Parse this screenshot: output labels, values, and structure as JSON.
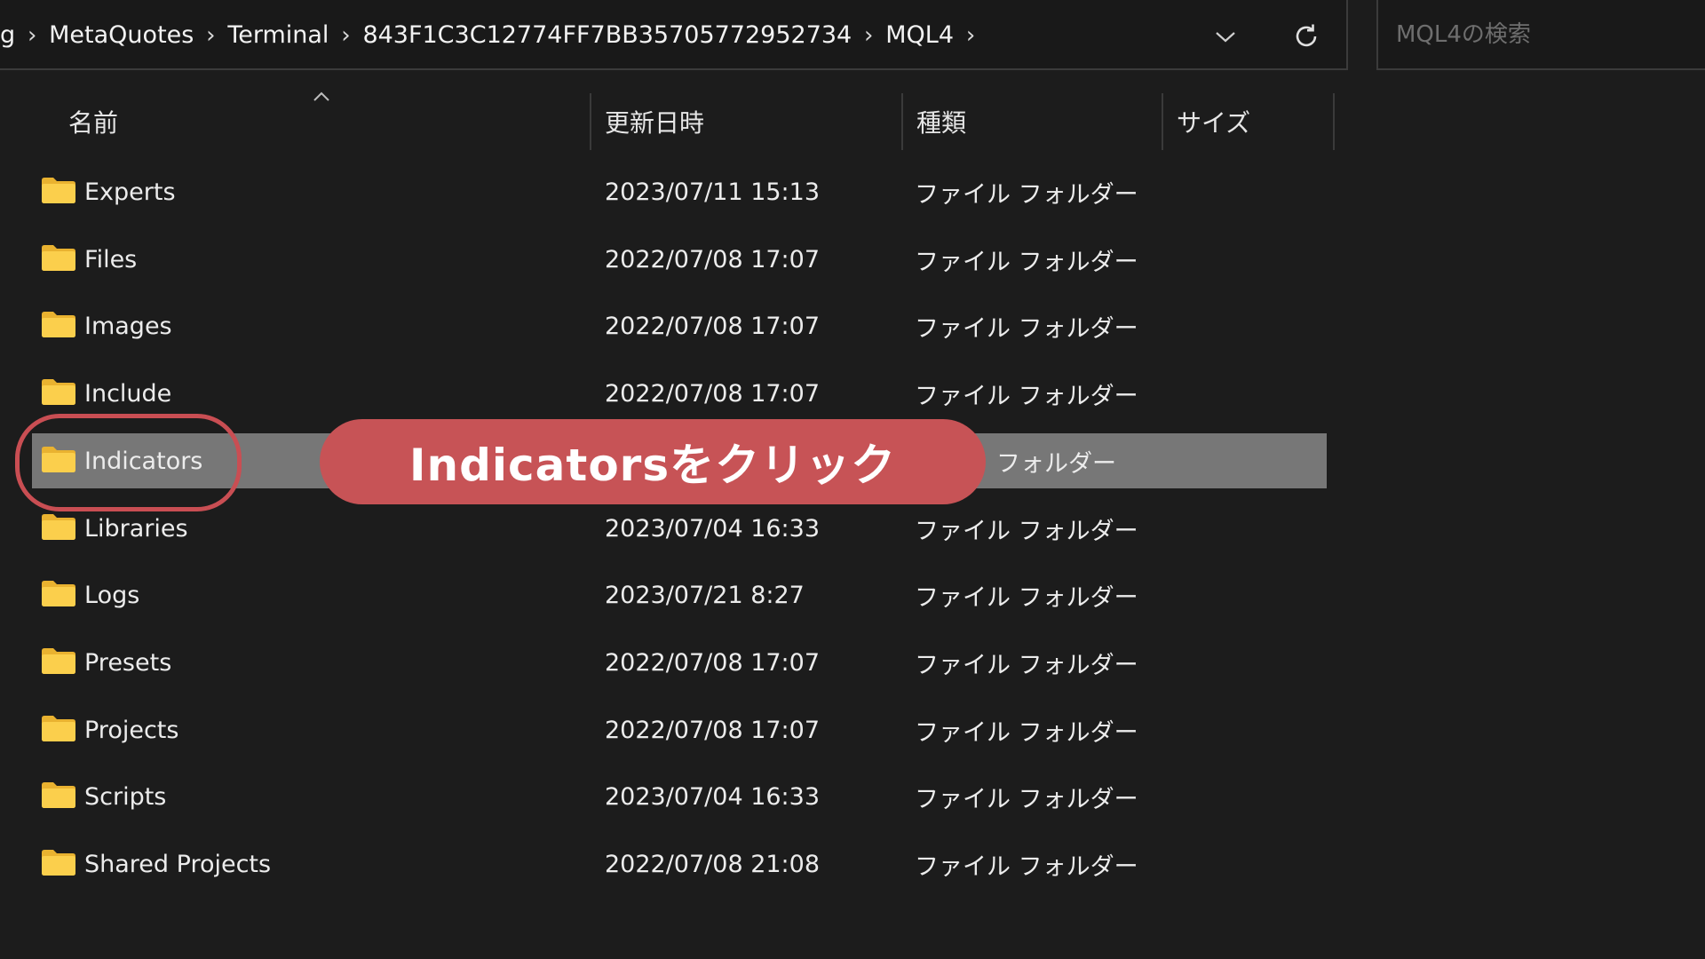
{
  "address_bar": {
    "breadcrumb": [
      "g",
      "MetaQuotes",
      "Terminal",
      "843F1C3C12774FF7BB35705772952734",
      "MQL4"
    ],
    "separator_icon": "chevron-right-icon",
    "dropdown_icon": "chevron-down-icon",
    "refresh_icon": "refresh-icon"
  },
  "search": {
    "placeholder": "MQL4の検索"
  },
  "columns": {
    "name": "名前",
    "date": "更新日時",
    "type": "種類",
    "size": "サイズ",
    "sort_icon": "sort-ascending-icon"
  },
  "rows": [
    {
      "name": "Experts",
      "date": "2023/07/11 15:13",
      "type": "ファイル フォルダー",
      "selected": false
    },
    {
      "name": "Files",
      "date": "2022/07/08 17:07",
      "type": "ファイル フォルダー",
      "selected": false
    },
    {
      "name": "Images",
      "date": "2022/07/08 17:07",
      "type": "ファイル フォルダー",
      "selected": false
    },
    {
      "name": "Include",
      "date": "2022/07/08 17:07",
      "type": "ファイル フォルダー",
      "selected": false
    },
    {
      "name": "Indicators",
      "date": "",
      "type": "フォルダー",
      "selected": true
    },
    {
      "name": "Libraries",
      "date": "2023/07/04 16:33",
      "type": "ファイル フォルダー",
      "selected": false
    },
    {
      "name": "Logs",
      "date": "2023/07/21 8:27",
      "type": "ファイル フォルダー",
      "selected": false
    },
    {
      "name": "Presets",
      "date": "2022/07/08 17:07",
      "type": "ファイル フォルダー",
      "selected": false
    },
    {
      "name": "Projects",
      "date": "2022/07/08 17:07",
      "type": "ファイル フォルダー",
      "selected": false
    },
    {
      "name": "Scripts",
      "date": "2023/07/04 16:33",
      "type": "ファイル フォルダー",
      "selected": false
    },
    {
      "name": "Shared Projects",
      "date": "2022/07/08 21:08",
      "type": "ファイル フォルダー",
      "selected": false
    }
  ],
  "annotation": {
    "callout_text": "Indicatorsをクリック",
    "color": "#c75356"
  },
  "colors": {
    "background": "#1c1c1c",
    "folder": "#f4c542",
    "selected_row": "#777777"
  }
}
